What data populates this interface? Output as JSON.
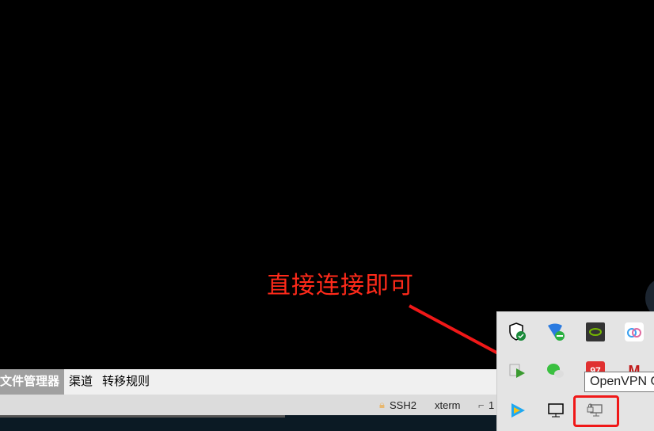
{
  "toolbar": {
    "tabs": [
      "文件管理器",
      "渠道",
      "转移规则"
    ]
  },
  "status": {
    "protocol": "SSH2",
    "terminal": "xterm",
    "extra": "1"
  },
  "annotation": "直接连接即可",
  "tray": {
    "tooltip": "OpenVPN GUI",
    "icons": [
      "windows-security-icon",
      "network-shield-icon",
      "nvidia-icon",
      "baidu-netdisk-icon",
      "media-player-icon",
      "wechat-icon",
      "qq-icon",
      "mcafee-icon",
      "tencent-video-icon",
      "network-monitor-icon",
      "openvpn-icon"
    ]
  },
  "colors": {
    "annotation": "#ff2a1a",
    "highlight": "#f01818"
  }
}
